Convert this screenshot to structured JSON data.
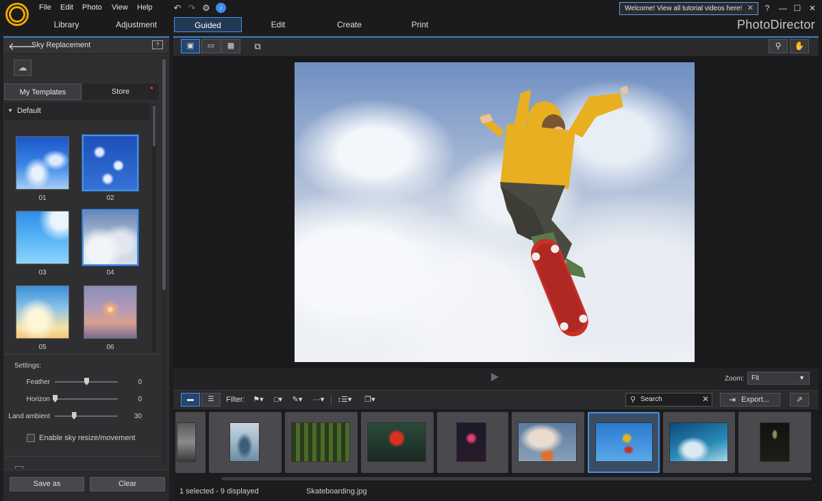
{
  "menu": [
    "File",
    "Edit",
    "Photo",
    "View",
    "Help"
  ],
  "welcome_banner": "Welcome! View all tutorial videos here!",
  "window_controls": {
    "help": "?",
    "minimize": "—",
    "maximize": "☐",
    "close": "✕"
  },
  "modules": [
    "Library",
    "Adjustment",
    "Guided",
    "Edit",
    "Create",
    "Print"
  ],
  "active_module": "Guided",
  "brand": "PhotoDirector",
  "panel": {
    "title": "Sky Replacement",
    "tabs": [
      "My Templates",
      "Store"
    ],
    "category": "Default",
    "templates": [
      "01",
      "02",
      "03",
      "04",
      "05",
      "06"
    ],
    "selected_templates": [
      "02",
      "04"
    ]
  },
  "settings": {
    "label": "Settings:",
    "sliders": [
      {
        "label": "Feather",
        "value": "0",
        "fraction": 0.5
      },
      {
        "label": "Horizon",
        "value": "0",
        "fraction": 0.0
      },
      {
        "label": "Land ambient",
        "value": "30",
        "fraction": 0.3
      }
    ],
    "checkbox_label": "Enable sky resize/movement",
    "checkbox_checked": false
  },
  "footer": {
    "save_as": "Save as",
    "clear": "Clear"
  },
  "viewer": {
    "zoom_label": "Zoom:",
    "zoom_value": "Fit"
  },
  "strip": {
    "filter_label": "Filter:",
    "search_placeholder": "Search",
    "export_label": "Export...",
    "status_selected": "1 selected - 9 displayed",
    "status_filename": "Skateboarding.jpg"
  },
  "icons": {
    "undo": "undo-icon",
    "redo": "redo-icon",
    "settings": "gear-icon",
    "notify": "notification-icon",
    "back": "back-arrow-icon",
    "help": "help-icon",
    "add": "add-sky-icon",
    "zoom": "magnifier-icon",
    "hand": "hand-icon",
    "play": "play-icon",
    "search": "search-icon",
    "export": "export-icon",
    "share": "share-icon"
  },
  "colors": {
    "accent": "#4a90e2",
    "logo": "#f2a900",
    "panel": "#2f2f32",
    "background": "#1e1e20"
  }
}
